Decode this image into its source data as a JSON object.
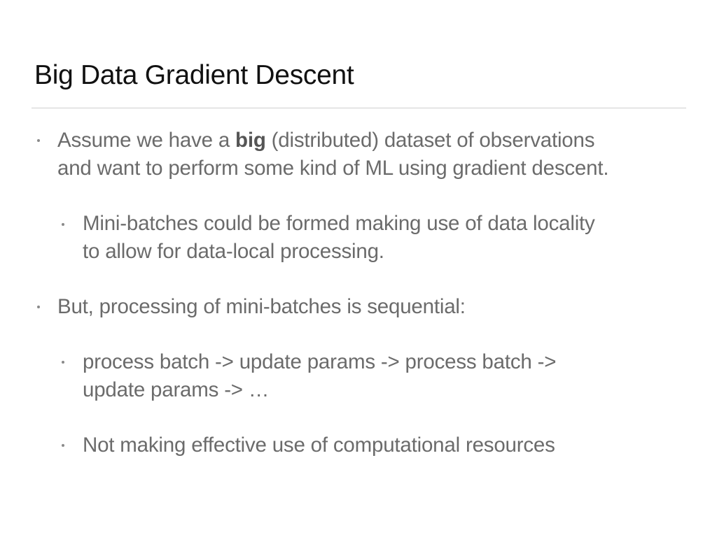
{
  "slide": {
    "title": "Big Data Gradient Descent",
    "bullets": {
      "b1": {
        "prefix": "Assume we have a ",
        "bold": "big",
        "line1_rest": " (distributed) dataset of observations",
        "line2": "and want to perform some kind of ML using gradient descent."
      },
      "b1_sub": {
        "line1": "Mini-batches could be formed making use of data locality",
        "line2": "to allow for data-local processing."
      },
      "b2": {
        "line1": "But, processing of mini-batches is sequential:"
      },
      "b2_sub1": {
        "line1": "process batch -> update params -> process batch ->",
        "line2": "update params -> …"
      },
      "b2_sub2": {
        "line1": "Not making effective use of computational resources"
      }
    }
  }
}
